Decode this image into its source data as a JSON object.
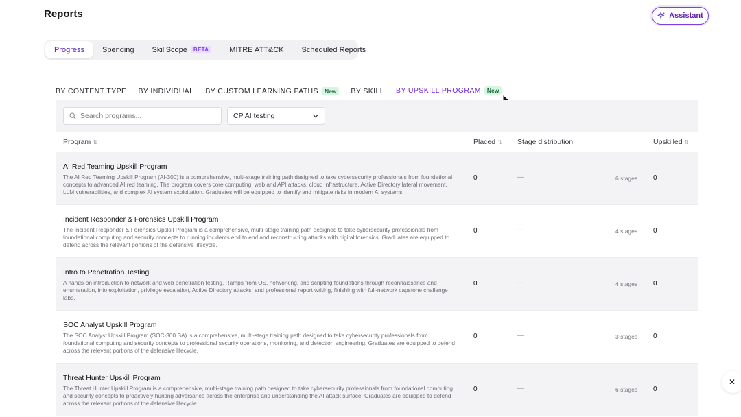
{
  "header": {
    "title": "Reports",
    "assistant_label": "Assistant"
  },
  "top_tabs": [
    {
      "label": "Progress",
      "active": true
    },
    {
      "label": "Spending"
    },
    {
      "label": "SkillScope",
      "badge": "BETA"
    },
    {
      "label": "MITRE ATT&CK"
    },
    {
      "label": "Scheduled Reports"
    }
  ],
  "sub_tabs": [
    {
      "label": "BY CONTENT TYPE"
    },
    {
      "label": "BY INDIVIDUAL"
    },
    {
      "label": "BY CUSTOM LEARNING PATHS",
      "badge": "New"
    },
    {
      "label": "BY SKILL"
    },
    {
      "label": "BY UPSKILL PROGRAM",
      "badge": "New",
      "active": true
    }
  ],
  "filters": {
    "search_placeholder": "Search programs...",
    "selected_program": "CP AI testing"
  },
  "table": {
    "columns": {
      "program": "Program",
      "placed": "Placed",
      "stage_distribution": "Stage distribution",
      "upskilled": "Upskilled"
    },
    "rows": [
      {
        "title": "AI Red Teaming Upskill Program",
        "description": "The AI Red Teaming Upskill Program (AI-300) is a comprehensive, multi-stage training path designed to take cybersecurity professionals from foundational concepts to advanced AI red teaming. The program covers core computing, web and API attacks, cloud infrastructure, Active Directory lateral movement, LLM vulnerabilities, and complex AI system exploitation. Graduates will be equipped to identify and mitigate risks in modern AI systems.",
        "placed": "0",
        "distribution": "—",
        "stages": "6 stages",
        "upskilled": "0"
      },
      {
        "title": "Incident Responder & Forensics Upskill Program",
        "description": "The Incident Responder & Forensics Upskill Program is a comprehensive, multi-stage training path designed to take cybersecurity professionals from foundational computing and security concepts to running incidents end to end and reconstructing attacks with digital forensics. Graduates are equipped to defend across the relevant portions of the defensive lifecycle.",
        "placed": "0",
        "distribution": "—",
        "stages": "4 stages",
        "upskilled": "0"
      },
      {
        "title": "Intro to Penetration Testing",
        "description": "A hands-on introduction to network and web penetration testing. Ramps from OS, networking, and scripting foundations through reconnaissance and enumeration, into exploitation, privilege escalation, Active Directory attacks, and professional report writing, finishing with full-network capstone challenge labs.",
        "placed": "0",
        "distribution": "—",
        "stages": "4 stages",
        "upskilled": "0"
      },
      {
        "title": "SOC Analyst Upskill Program",
        "description": "The SOC Analyst Upskill Program (SOC-300 SA) is a comprehensive, multi-stage training path designed to take cybersecurity professionals from foundational computing and security concepts to professional security operations, monitoring, and detection engineering. Graduates are equipped to defend across the relevant portions of the defensive lifecycle.",
        "placed": "0",
        "distribution": "—",
        "stages": "3 stages",
        "upskilled": "0"
      },
      {
        "title": "Threat Hunter Upskill Program",
        "description": "The Threat Hunter Upskill Program is a comprehensive, multi-stage training path designed to take cybersecurity professionals from foundational computing and security concepts to proactively hunting adversaries across the enterprise and understanding the AI attack surface. Graduates are equipped to defend across the relevant portions of the defensive lifecycle.",
        "placed": "0",
        "distribution": "—",
        "stages": "6 stages",
        "upskilled": "0"
      }
    ]
  },
  "icons": {
    "sort": "⇅",
    "close": "✕"
  },
  "colors": {
    "accent": "#6d28d9",
    "new_badge_bg": "#d7f5e3",
    "beta_badge_bg": "#e9dcfc",
    "shaded_row": "#f3f3f5"
  }
}
